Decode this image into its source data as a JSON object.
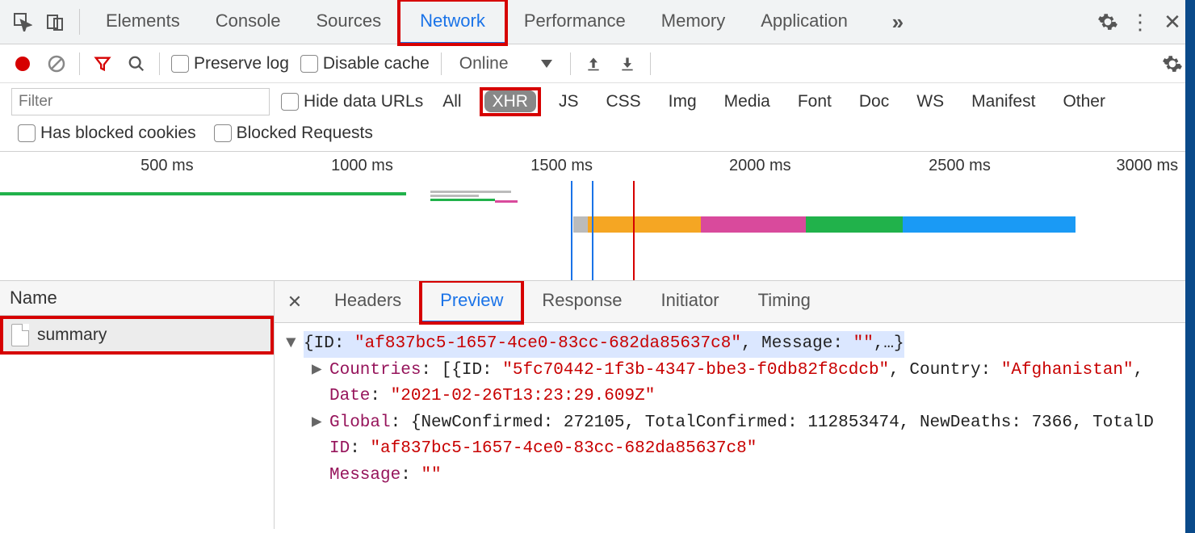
{
  "main_tabs": {
    "elements": "Elements",
    "console": "Console",
    "sources": "Sources",
    "network": "Network",
    "performance": "Performance",
    "memory": "Memory",
    "application": "Application"
  },
  "toolbar": {
    "preserve_log": "Preserve log",
    "disable_cache": "Disable cache",
    "throttling": "Online"
  },
  "filter": {
    "placeholder": "Filter",
    "hide_data_urls": "Hide data URLs",
    "types": {
      "all": "All",
      "xhr": "XHR",
      "js": "JS",
      "css": "CSS",
      "img": "Img",
      "media": "Media",
      "font": "Font",
      "doc": "Doc",
      "ws": "WS",
      "manifest": "Manifest",
      "other": "Other"
    },
    "has_blocked_cookies": "Has blocked cookies",
    "blocked_requests": "Blocked Requests"
  },
  "overview_ticks": {
    "t500": "500 ms",
    "t1000": "1000 ms",
    "t1500": "1500 ms",
    "t2000": "2000 ms",
    "t2500": "2500 ms",
    "t3000": "3000 ms"
  },
  "requests": {
    "name_header": "Name",
    "items": [
      {
        "name": "summary"
      }
    ]
  },
  "detail_tabs": {
    "headers": "Headers",
    "preview": "Preview",
    "response": "Response",
    "initiator": "Initiator",
    "timing": "Timing"
  },
  "preview": {
    "root_id_key": "ID",
    "root_id_val": "\"af837bc5-1657-4ce0-83cc-682da85637c8\"",
    "root_msg_key": "Message",
    "root_msg_val": "\"\"",
    "countries_key": "Countries",
    "countries_open": "[{ID: ",
    "country_id_val": "\"5fc70442-1f3b-4347-bbe3-f0db82f8cdcb\"",
    "country_key": "Country",
    "country_val": "\"Afghanistan\"",
    "date_key": "Date",
    "date_val": "\"2021-02-26T13:23:29.609Z\"",
    "global_key": "Global",
    "global_body": "{NewConfirmed: 272105, TotalConfirmed: 112853474, NewDeaths: 7366, TotalD",
    "id_key": "ID",
    "id_val": "\"af837bc5-1657-4ce0-83cc-682da85637c8\"",
    "msg_key": "Message",
    "msg_val": "\"\""
  }
}
